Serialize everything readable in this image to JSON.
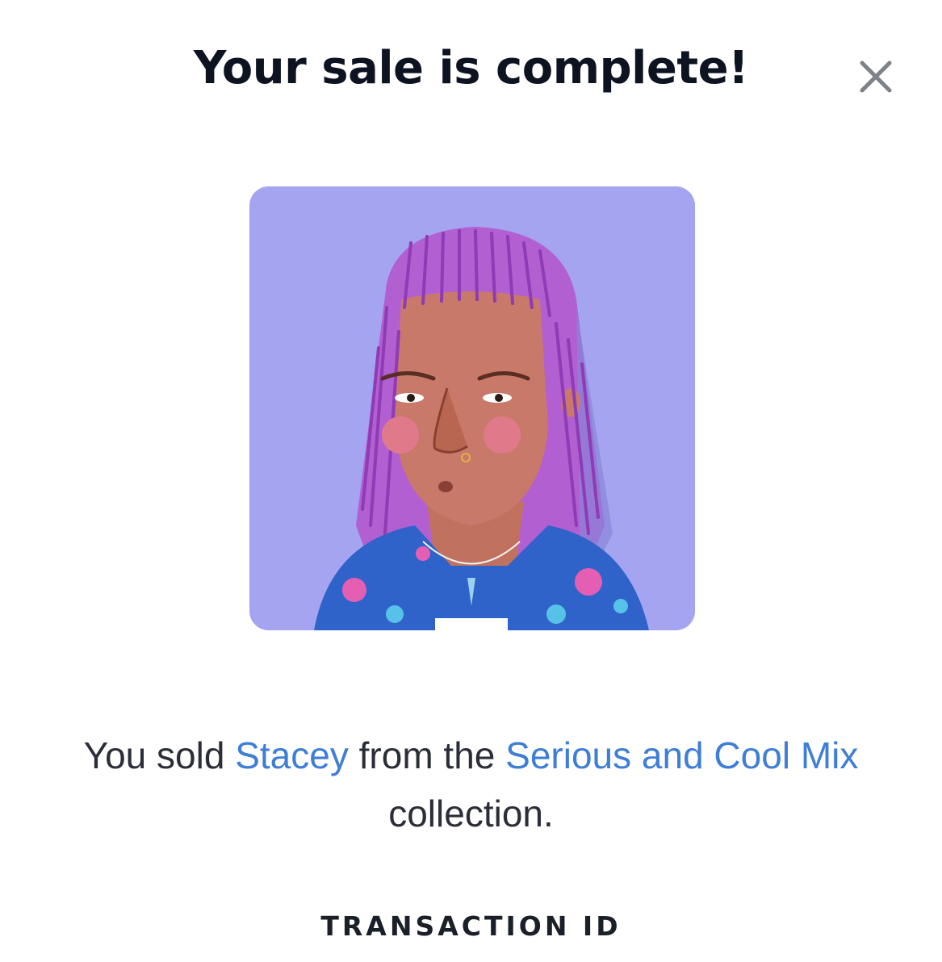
{
  "modal": {
    "title": "Your sale is complete!",
    "close_icon": "close-icon"
  },
  "nft": {
    "image_description": "stacey-avatar-illustration"
  },
  "message": {
    "prefix": "You sold ",
    "item_name": "Stacey",
    "middle": " from the ",
    "collection_name": "Serious and Cool Mix",
    "suffix": " collection."
  },
  "transaction": {
    "label": "TRANSACTION ID"
  },
  "colors": {
    "link": "#3f7ed6",
    "title": "#0d1320",
    "body_text": "#2b2e38",
    "image_background": "#a5a4f0"
  }
}
